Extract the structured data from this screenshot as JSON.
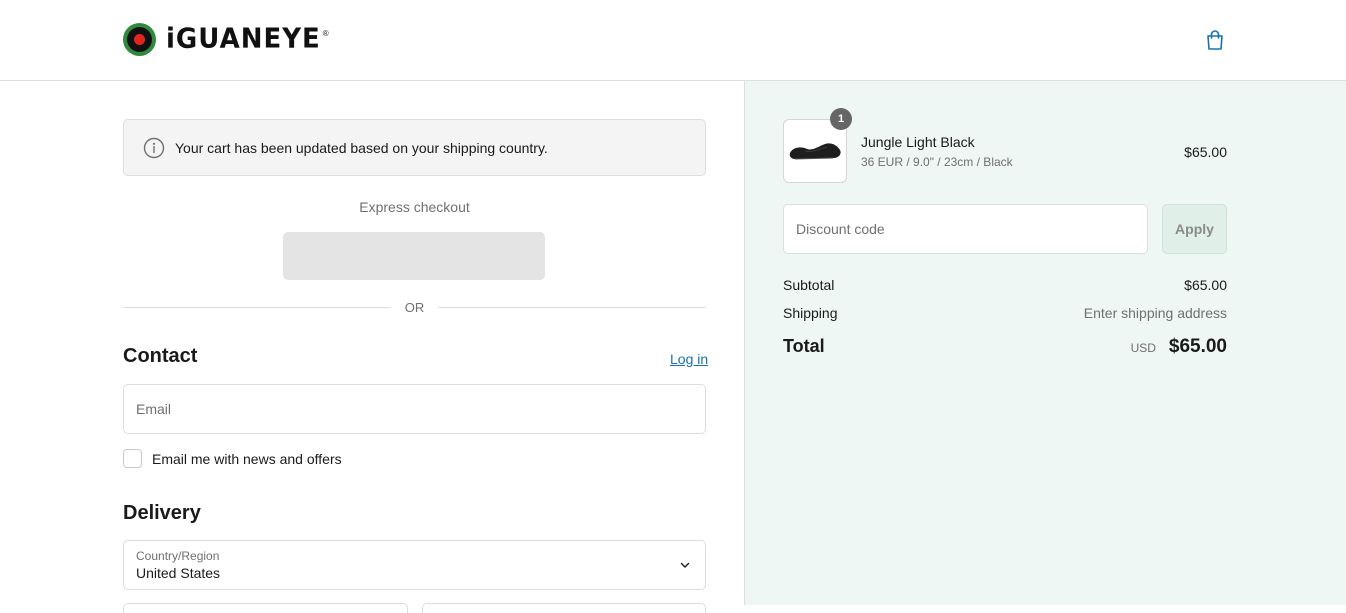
{
  "header": {
    "logo_text": "iGUANEYE",
    "logo_reg": "®"
  },
  "notice": {
    "text": "Your cart has been updated based on your shipping country."
  },
  "express": {
    "label": "Express checkout",
    "divider": "OR"
  },
  "contact": {
    "title": "Contact",
    "login_link": "Log in",
    "email_placeholder": "Email",
    "newsletter_label": "Email me with news and offers",
    "newsletter_checked": false
  },
  "delivery": {
    "title": "Delivery",
    "country_label": "Country/Region",
    "country_value": "United States"
  },
  "order": {
    "quantity": "1",
    "product_name": "Jungle Light Black",
    "product_variant": "36 EUR / 9.0\" / 23cm / Black",
    "product_price": "$65.00",
    "discount_placeholder": "Discount code",
    "apply_label": "Apply",
    "subtotal_label": "Subtotal",
    "subtotal_value": "$65.00",
    "shipping_label": "Shipping",
    "shipping_value": "Enter shipping address",
    "total_label": "Total",
    "total_currency": "USD",
    "total_value": "$65.00"
  },
  "colors": {
    "accent_link": "#1773b0",
    "summary_bg": "#eef7f3",
    "brand_green": "#2f8a3e",
    "brand_red": "#e2261d"
  },
  "icons": {
    "cart": "shopping-bag-icon",
    "info": "info-icon",
    "chevron": "chevron-down-icon"
  }
}
